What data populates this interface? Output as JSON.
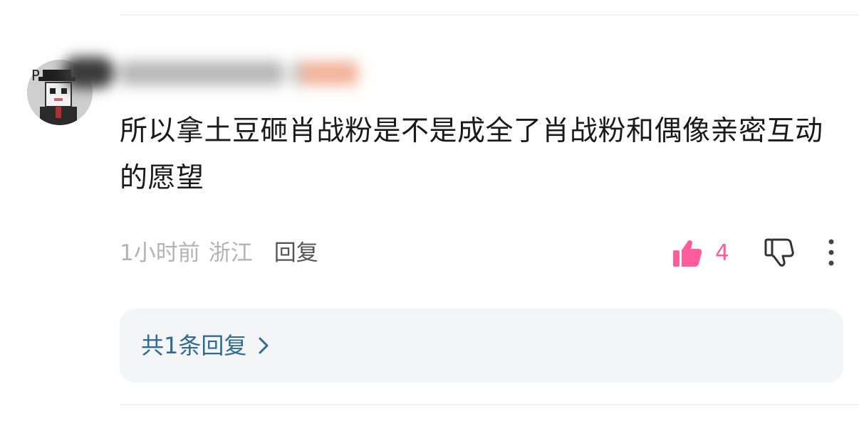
{
  "comment": {
    "avatar_badge": "P",
    "text": "所以拿土豆砸肖战粉是不是成全了肖战粉和偶像亲密互动的愿望",
    "time": "1小时前",
    "location": "浙江",
    "reply_label": "回复",
    "like_count": "4",
    "replies_summary": "共1条回复"
  },
  "colors": {
    "like": "#ff5c9b",
    "reply_link": "#2d6b96",
    "meta": "#b3b3b3"
  },
  "icons": [
    "thumbs-up-icon",
    "thumbs-down-icon",
    "more-vertical-icon",
    "chevron-right-icon"
  ]
}
